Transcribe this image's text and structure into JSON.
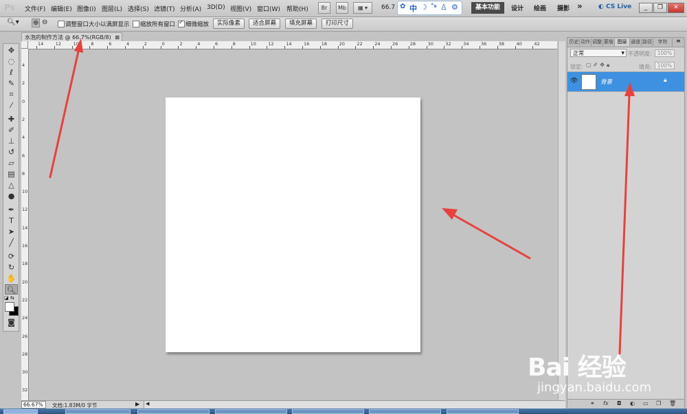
{
  "app": {
    "logo": "Ps"
  },
  "menu": [
    "文件(F)",
    "编辑(E)",
    "图像(I)",
    "图层(L)",
    "选择(S)",
    "滤镜(T)",
    "分析(A)",
    "3D(D)",
    "视图(V)",
    "窗口(W)",
    "帮助(H)"
  ],
  "menubar": {
    "bridge_btn": "Br",
    "minibridge_btn": "Mb",
    "arrange_btn": "▦ ▾",
    "zoom_level": "66.7",
    "ime": {
      "lang": "中",
      "icons": [
        "moon-icon",
        "dots-icon",
        "shirt-icon",
        "gear-icon"
      ]
    },
    "workspaces": [
      "基本功能",
      "设计",
      "绘画",
      "摄影"
    ],
    "more": "»",
    "cs_live": "CS Live",
    "window_controls": [
      "_",
      "❐",
      "✕"
    ]
  },
  "options_bar": {
    "checkboxes": [
      {
        "label": "调整窗口大小以满屏显示",
        "checked": false
      },
      {
        "label": "缩放所有窗口",
        "checked": false
      },
      {
        "label": "细微缩放",
        "checked": true
      }
    ],
    "buttons": [
      "实际像素",
      "适合屏幕",
      "填充屏幕",
      "打印尺寸"
    ]
  },
  "document": {
    "tab_title": "水泡的制作方法 @ 66.7%(RGB/8)",
    "ruler_top": [
      "14",
      "12",
      "10",
      "8",
      "6",
      "4",
      "2",
      "0",
      "2",
      "4",
      "6",
      "8",
      "10",
      "12",
      "14",
      "16",
      "18",
      "20",
      "22",
      "24",
      "26",
      "28",
      "30",
      "32",
      "34",
      "36",
      "38",
      "40",
      "42"
    ],
    "ruler_left": [
      "4",
      "2",
      "0",
      "2",
      "4",
      "6",
      "8",
      "10",
      "12",
      "14",
      "16",
      "18",
      "20",
      "22",
      "24",
      "26",
      "28",
      "30",
      "32"
    ]
  },
  "status": {
    "zoom": "66.67%",
    "doc_info": "文档:1.83M/0 字节"
  },
  "layers_panel": {
    "tabs": [
      "历史",
      "动作",
      "调整",
      "蒙版",
      "图层",
      "通道",
      "路径",
      "字符"
    ],
    "active_tab": "图层",
    "blend_mode": "正常",
    "opacity_label": "不透明度:",
    "opacity_value": "100%",
    "lock_label": "锁定:",
    "fill_label": "填充:",
    "fill_value": "100%",
    "layers": [
      {
        "name": "背景",
        "visible": true,
        "locked": true
      }
    ],
    "footer_icons": [
      "link-icon",
      "fx-icon",
      "mask-icon",
      "adjustment-icon",
      "group-icon",
      "new-layer-icon",
      "trash-icon"
    ]
  },
  "watermark": {
    "logo": "Bai 经验",
    "url": "jingyan.baidu.com"
  },
  "colors": {
    "accent_layer": "#3d91e0",
    "arrow": "#e8403c",
    "workspace_active": "#4a4a4a"
  }
}
